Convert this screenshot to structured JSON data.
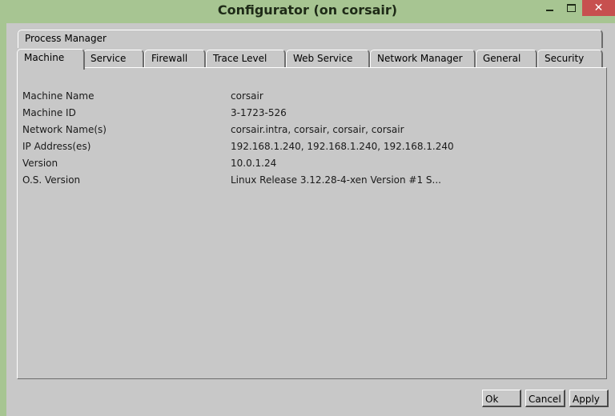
{
  "window": {
    "title": "Configurator (on corsair)",
    "close_glyph": "✕"
  },
  "tabs": {
    "row2": [
      {
        "label": "Process Manager"
      }
    ],
    "row1": [
      {
        "label": "Machine",
        "selected": true
      },
      {
        "label": "Service"
      },
      {
        "label": "Firewall"
      },
      {
        "label": "Trace Level"
      },
      {
        "label": "Web Service"
      },
      {
        "label": "Network Manager"
      },
      {
        "label": "General"
      },
      {
        "label": "Security"
      }
    ]
  },
  "machine": {
    "rows": [
      {
        "label": "Machine Name",
        "value": "corsair"
      },
      {
        "label": "Machine ID",
        "value": "3-1723-526"
      },
      {
        "label": "Network Name(s)",
        "value": "corsair.intra, corsair, corsair, corsair"
      },
      {
        "label": "IP Address(es)",
        "value": "192.168.1.240, 192.168.1.240, 192.168.1.240"
      },
      {
        "label": "Version",
        "value": "10.0.1.24"
      },
      {
        "label": "O.S. Version",
        "value": "Linux Release 3.12.28-4-xen Version #1 S..."
      }
    ]
  },
  "buttons": {
    "ok": "Ok",
    "cancel": "Cancel",
    "apply": "Apply"
  },
  "colors": {
    "window_frame": "#a7c592",
    "close_button": "#c7504f",
    "panel": "#c8c8c8"
  }
}
